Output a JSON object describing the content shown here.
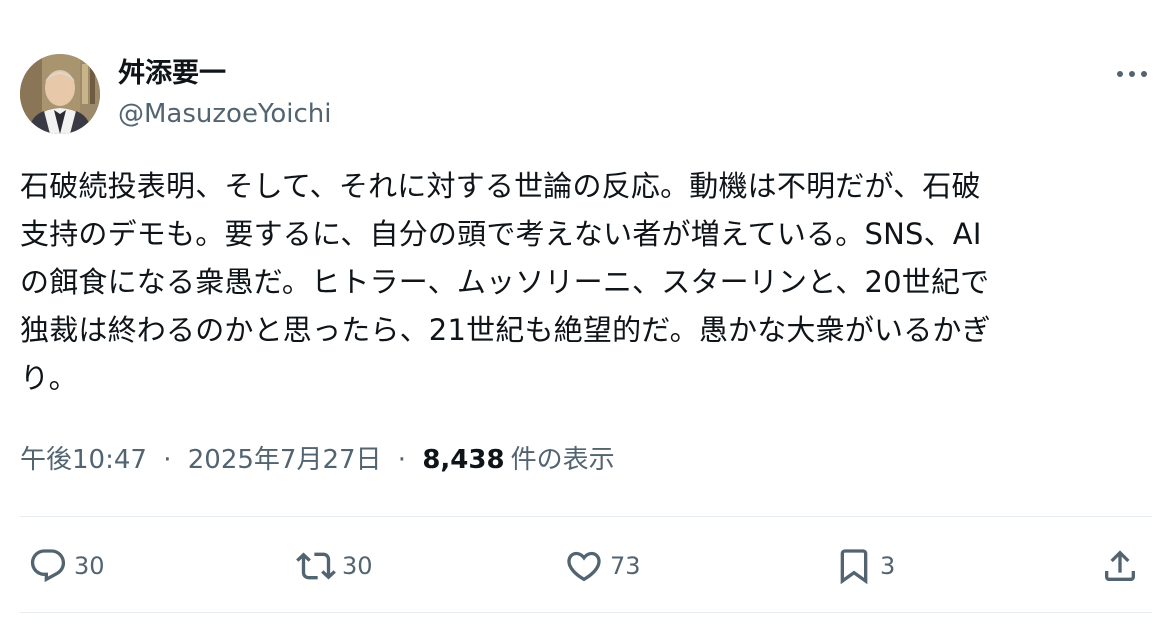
{
  "author": {
    "name": "舛添要一",
    "handle": "@MasuzoeYoichi"
  },
  "body_lines": [
    "石破続投表明、そして、それに対する世論の反応。動機は不明だが、石破",
    "支持のデモも。要するに、自分の頭で考えない者が増えている。SNS、AI",
    "の餌食になる衆愚だ。ヒトラー、ムッソリーニ、スターリンと、20世紀で",
    "独裁は終わるのかと思ったら、21世紀も絶望的だ。愚かな大衆がいるかぎ",
    "り。"
  ],
  "meta": {
    "time": "午後10:47",
    "separator": "·",
    "date": "2025年7月27日",
    "views": "8,438",
    "views_label": "件の表示"
  },
  "actions": {
    "reply_count": "30",
    "retweet_count": "30",
    "like_count": "73",
    "bookmark_count": "3"
  },
  "icons": {
    "more": "more-horizontal-icon",
    "reply": "reply-bubble-icon",
    "retweet": "retweet-icon",
    "like": "heart-icon",
    "bookmark": "bookmark-icon",
    "share": "share-upload-icon"
  },
  "colors": {
    "text": "#0f1419",
    "secondary": "#536471",
    "divider": "#e6ecf0"
  }
}
